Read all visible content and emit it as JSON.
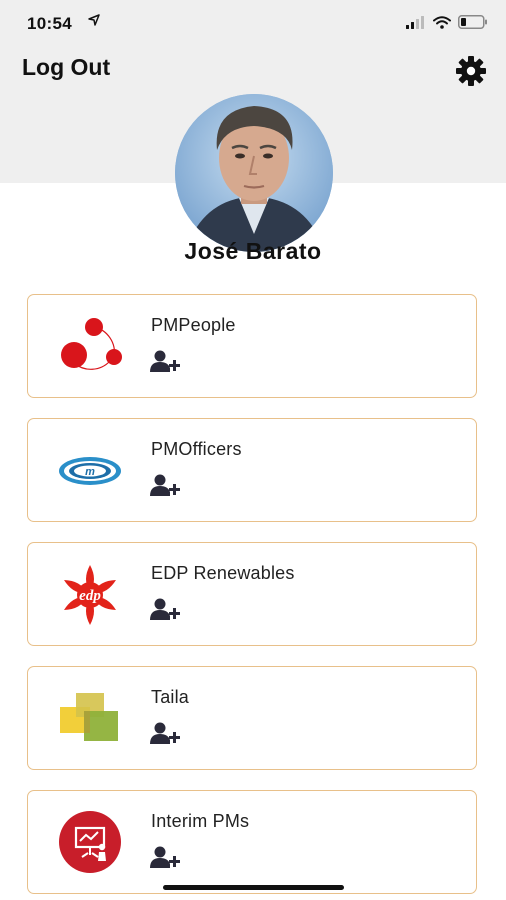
{
  "status_bar": {
    "time": "10:54"
  },
  "header": {
    "logout_label": "Log Out"
  },
  "profile": {
    "name": "José Barato"
  },
  "organizations": [
    {
      "name": "PMPeople",
      "logo": "pmpeople-logo"
    },
    {
      "name": "PMOfficers",
      "logo": "pmofficers-logo"
    },
    {
      "name": "EDP Renewables",
      "logo": "edp-logo",
      "logo_text": "edp"
    },
    {
      "name": "Taila",
      "logo": "taila-logo"
    },
    {
      "name": "Interim PMs",
      "logo": "interim-pms-logo"
    }
  ],
  "colors": {
    "card_border": "#e8c08a",
    "header_bg": "#efefef",
    "pmpeople_red": "#d9151b",
    "edp_red": "#e2231a"
  }
}
